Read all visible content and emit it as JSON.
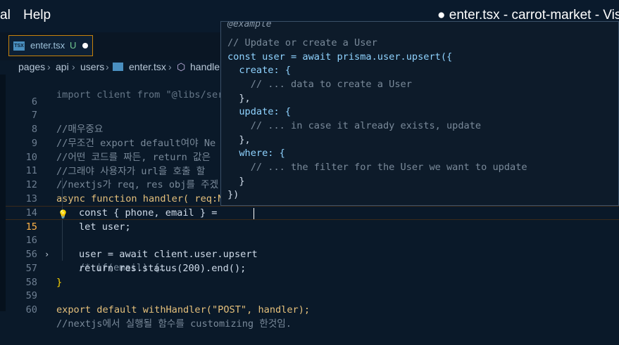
{
  "menubar": {
    "items": [
      "al",
      "Help"
    ],
    "window_title": "● enter.tsx - carrot-market - Visu"
  },
  "tab": {
    "icon_text": "TSX",
    "label": "enter.tsx",
    "status": "U"
  },
  "breadcrumb": [
    "pages",
    "api",
    "users",
    "enter.tsx",
    "handle"
  ],
  "editor": {
    "lines": [
      {
        "n": "",
        "t": "import client from \"@libs/ser"
      },
      {
        "n": "6",
        "t": ""
      },
      {
        "n": "7",
        "t": "//매우중요"
      },
      {
        "n": "8",
        "t": "//무조건 export default여야 Ne"
      },
      {
        "n": "9",
        "t": "//어떤 코드를 짜든, return 값은"
      },
      {
        "n": "10",
        "t": "//그래야 사용자가 url을 호출 할"
      },
      {
        "n": "11",
        "t": "//nextjs가 req, res obj를 주겠"
      },
      {
        "n": "12",
        "t": "async function handler( req:N"
      },
      {
        "n": "13",
        "t": "const { phone, email } ="
      },
      {
        "n": "14",
        "t": "let user;"
      },
      {
        "n": "15",
        "t": "user = await client.user.upsert"
      },
      {
        "n": "16",
        "t": "/* if(email) {…"
      },
      {
        "n": "56",
        "t": "return res.status(200).end();"
      },
      {
        "n": "57",
        "t": "}"
      },
      {
        "n": "58",
        "t": ""
      },
      {
        "n": "59",
        "t": "export default withHandler(\"POST\", handler);"
      },
      {
        "n": "60",
        "t": "//nextjs에서 실행될 함수를 customizing 한것임."
      }
    ]
  },
  "hover": {
    "tag": "@example",
    "lines": [
      "// Update or create a User",
      "const user = await prisma.user.upsert({",
      "  create: {",
      "    // ... data to create a User",
      "  },",
      "  update: {",
      "    // ... in case it already exists, update",
      "  },",
      "  where: {",
      "    // ... the filter for the User we want to update",
      "  }",
      "})"
    ]
  }
}
